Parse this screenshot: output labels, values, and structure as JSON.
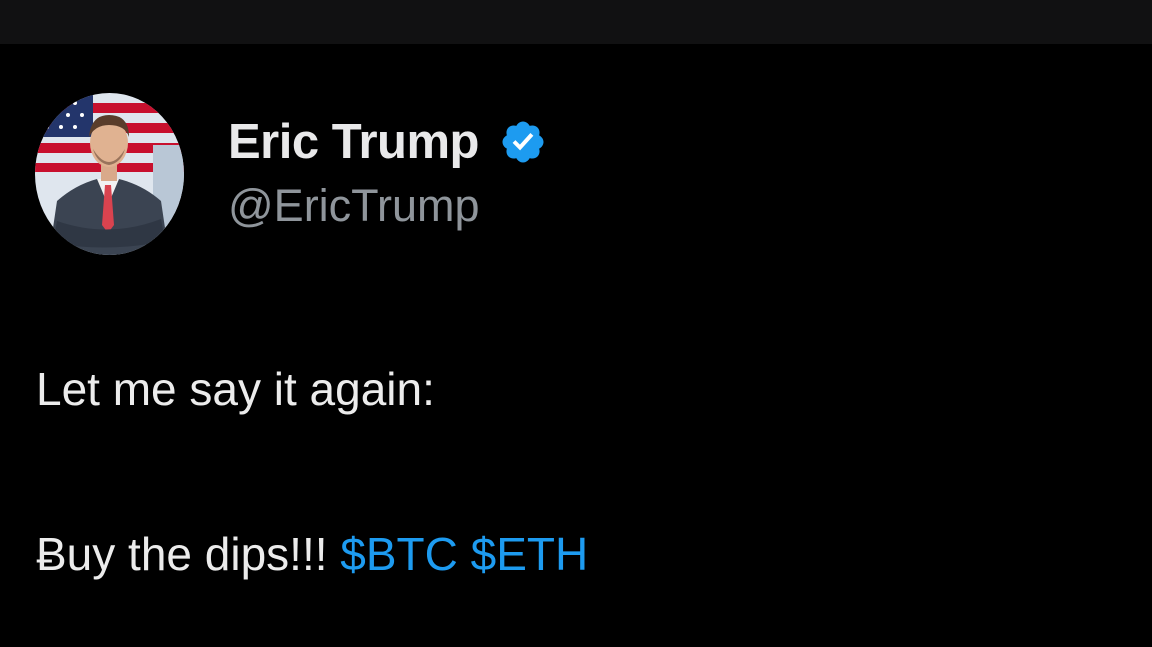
{
  "author": {
    "display_name": "Eric Trump",
    "handle": "@EricTrump",
    "verified": true,
    "verified_color": "#1d9bf0",
    "avatar_icon": "profile-photo-flag-background"
  },
  "tweet": {
    "line1": "Let me say it again:",
    "line2_text": "Ƀuy the dips!!!",
    "cashtags": [
      "$BTC",
      "$ETH"
    ],
    "cashtag_color": "#1d9bf0"
  },
  "colors": {
    "background": "#000000",
    "topbar": "#111112",
    "primary_text": "#e7e9ea",
    "secondary_text": "#8f959b"
  }
}
